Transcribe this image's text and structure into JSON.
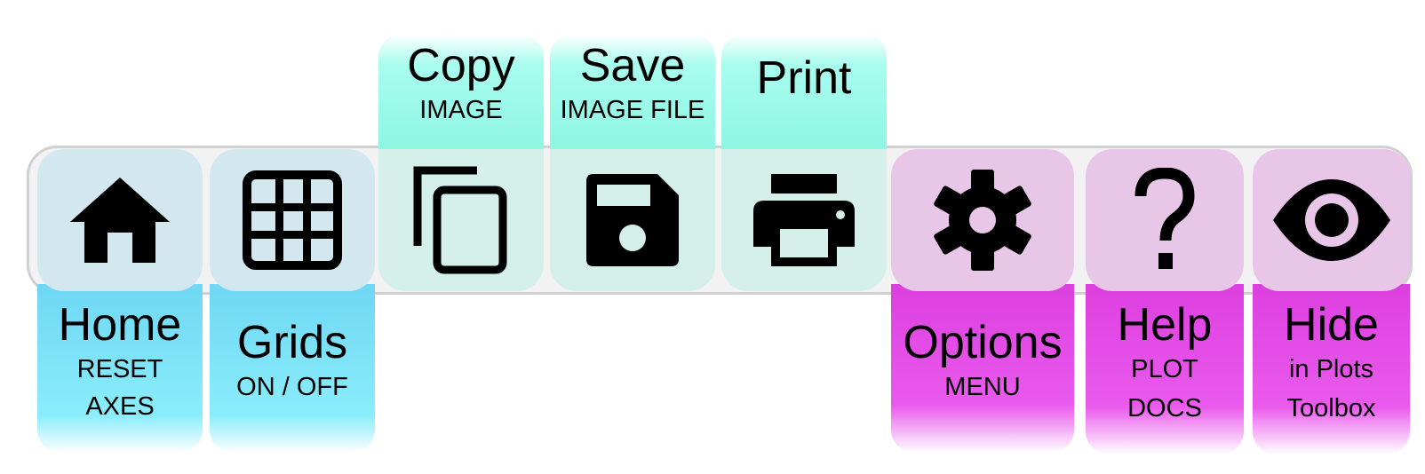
{
  "toolbar": {
    "buttons": [
      {
        "id": "home",
        "icon": "home-icon",
        "title": "Home",
        "sub1": "RESET",
        "sub2": "AXES",
        "group": "blue"
      },
      {
        "id": "grids",
        "icon": "grid-icon",
        "title": "Grids",
        "sub1": "ON / OFF",
        "sub2": "",
        "group": "blue"
      },
      {
        "id": "copy",
        "icon": "copy-icon",
        "title": "Copy",
        "sub1": "IMAGE",
        "sub2": "",
        "group": "mint"
      },
      {
        "id": "save",
        "icon": "floppy-disk-icon",
        "title": "Save",
        "sub1": "IMAGE FILE",
        "sub2": "",
        "group": "mint"
      },
      {
        "id": "print",
        "icon": "printer-icon",
        "title": "Print",
        "sub1": "",
        "sub2": "",
        "group": "mint"
      },
      {
        "id": "options",
        "icon": "gear-icon",
        "title": "Options",
        "sub1": "MENU",
        "sub2": "",
        "group": "pink"
      },
      {
        "id": "help",
        "icon": "question-mark-icon",
        "title": "Help",
        "sub1": "PLOT",
        "sub2": "DOCS",
        "group": "pink"
      },
      {
        "id": "hide",
        "icon": "eye-icon",
        "title": "Hide",
        "sub1": "in Plots",
        "sub2": "Toolbox",
        "group": "pink"
      }
    ]
  },
  "colors": {
    "blue_group": "#6fd7f4",
    "mint_group": "#8cf5e2",
    "pink_group": "#dc3fdf",
    "toolbar_bg": "#f2f2f2",
    "toolbar_border": "#d0d0d0"
  }
}
